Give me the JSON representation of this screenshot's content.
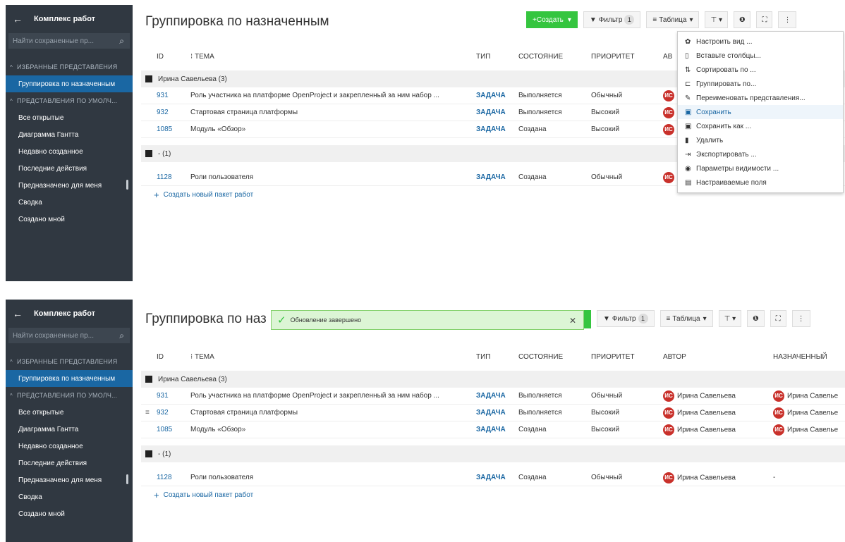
{
  "sidebar": {
    "back_label": "Комплекс работ",
    "search_placeholder": "Найти сохраненные пр...",
    "section_favorites": "ИЗБРАННЫЕ ПРЕДСТАВЛЕНИЯ",
    "active_item": "Группировка по назначенным",
    "section_default": "ПРЕДСТАВЛЕНИЯ ПО УМОЛЧ...",
    "items": [
      "Все открытые",
      "Диаграмма Гантта",
      "Недавно созданное",
      "Последние действия",
      "Предназначено для меня",
      "Сводка",
      "Создано мной"
    ]
  },
  "page_title": "Группировка по назначенным",
  "page_title_truncated": "Группировка по наз",
  "toolbar": {
    "create_label": "Создать",
    "filter_label": "Фильтр",
    "filter_count": "1",
    "view_label": "Таблица"
  },
  "columns": {
    "id": "ID",
    "subject": "ТЕМА",
    "type": "ТИП",
    "status": "СОСТОЯНИЕ",
    "priority": "ПРИОРИТЕТ",
    "author": "АВТОР",
    "author_truncated": "АВ",
    "assignee": "НАЗНАЧЕННЫЙ"
  },
  "groups": [
    {
      "label": "Ирина Савельева (3)",
      "rows": [
        {
          "id": "931",
          "subject": "Роль участника на платформе OpenProject и закрепленный за ним набор ...",
          "type": "ЗАДАЧА",
          "status": "Выполняется",
          "priority": "Обычный",
          "author": "Ирина Савельева",
          "assignee": "Ирина Савелье"
        },
        {
          "id": "932",
          "subject": "Стартовая страница платформы",
          "type": "ЗАДАЧА",
          "status": "Выполняется",
          "priority": "Высокий",
          "author": "Ирина Савельева",
          "assignee": "Ирина Савелье"
        },
        {
          "id": "1085",
          "subject": "Модуль «Обзор»",
          "type": "ЗАДАЧА",
          "status": "Создана",
          "priority": "Высокий",
          "author": "Ирина Савельева",
          "assignee": "Ирина Савелье"
        }
      ]
    },
    {
      "label": "- (1)",
      "rows": [
        {
          "id": "1128",
          "subject": "Роли пользователя",
          "type": "ЗАДАЧА",
          "status": "Создана",
          "priority": "Обычный",
          "author": "Ирина Савельева",
          "assignee": "-"
        }
      ]
    }
  ],
  "avatar_initials": "ИС",
  "add_work_package": "Создать новый пакет работ",
  "menu": [
    {
      "icon": "gear-icon",
      "glyph": "✿",
      "label": "Настроить вид ..."
    },
    {
      "icon": "columns-icon",
      "glyph": "▯",
      "label": "Вставьте столбцы..."
    },
    {
      "icon": "sort-icon",
      "glyph": "⇅",
      "label": "Сортировать по ..."
    },
    {
      "icon": "group-icon",
      "glyph": "⊏",
      "label": "Группировать по..."
    },
    {
      "icon": "pencil-icon",
      "glyph": "✎",
      "label": "Переименовать представления..."
    },
    {
      "icon": "save-icon",
      "glyph": "▣",
      "label": "Сохранить"
    },
    {
      "icon": "save-as-icon",
      "glyph": "▣",
      "label": "Сохранить как ..."
    },
    {
      "icon": "trash-icon",
      "glyph": "▮",
      "label": "Удалить"
    },
    {
      "icon": "export-icon",
      "glyph": "⇥",
      "label": "Экспортировать ..."
    },
    {
      "icon": "eye-icon",
      "glyph": "◉",
      "label": "Параметры видимости ..."
    },
    {
      "icon": "custom-fields-icon",
      "glyph": "▤",
      "label": "Настраиваемые поля"
    }
  ],
  "toast_message": "Обновление завершено",
  "colors": {
    "sidebar_bg": "#303841",
    "active_item": "#1a67a3",
    "create_button": "#35c53f",
    "link": "#1a67a3",
    "avatar": "#c9312b",
    "toast_bg": "#dcf5d5"
  }
}
